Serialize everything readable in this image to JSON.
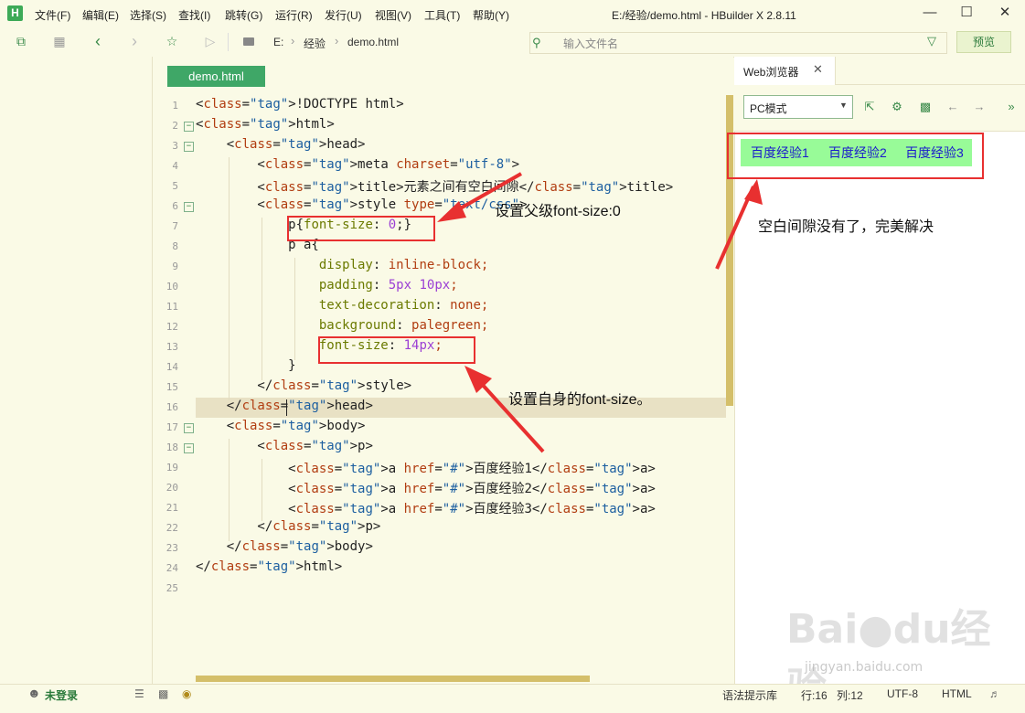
{
  "titlebar": {
    "app_logo": "H",
    "menu": [
      "文件(F)",
      "编辑(E)",
      "选择(S)",
      "查找(I)",
      "跳转(G)",
      "运行(R)",
      "发行(U)",
      "视图(V)",
      "工具(T)",
      "帮助(Y)"
    ],
    "window_title": "E:/经验/demo.html - HBuilder X 2.8.11"
  },
  "toolbar": {
    "breadcrumb": [
      "E:",
      "经验",
      "demo.html"
    ],
    "file_search_placeholder": "输入文件名",
    "preview_label": "预览"
  },
  "editor": {
    "tab_label": "demo.html",
    "line_numbers": [
      "1",
      "2",
      "3",
      "4",
      "5",
      "6",
      "7",
      "8",
      "9",
      "10",
      "11",
      "12",
      "13",
      "14",
      "15",
      "16",
      "17",
      "18",
      "19",
      "20",
      "21",
      "22",
      "23",
      "24",
      "25"
    ],
    "lines": [
      "<!DOCTYPE html>",
      "<html>",
      "    <head>",
      "        <meta charset=\"utf-8\">",
      "        <title>元素之间有空白间隙</title>",
      "        <style type=\"text/css\">",
      "            p{font-size: 0;}",
      "            p a{",
      "                display: inline-block;",
      "                padding: 5px 10px;",
      "                text-decoration: none;",
      "                background: palegreen;",
      "                font-size: 14px;",
      "            }",
      "        </style>",
      "    </head>",
      "    <body>",
      "        <p>",
      "            <a href=\"#\">百度经验1</a>",
      "            <a href=\"#\">百度经验2</a>",
      "            <a href=\"#\">百度经验3</a>",
      "        </p>",
      "    </body>",
      "</html>",
      ""
    ],
    "current_line": 16
  },
  "annotations": {
    "parent_font_size": "设置父级font-size:0",
    "self_font_size": "设置自身的font-size。",
    "result": "空白间隙没有了，完美解决"
  },
  "browser": {
    "tab_label": "Web浏览器",
    "mode_select": "PC模式",
    "links": [
      "百度经验1",
      "百度经验2",
      "百度经验3"
    ],
    "link_background": "#98fb98"
  },
  "statusbar": {
    "login": "未登录",
    "syntax_lib": "语法提示库",
    "row": "行:16",
    "col": "列:12",
    "encoding": "UTF-8",
    "language": "HTML"
  },
  "watermark": {
    "brand": "Baidu经验",
    "url": "jingyan.baidu.com"
  },
  "colors": {
    "accent_green": "#3fa767",
    "annotation_red": "#e83030",
    "editor_bg": "#fafae6"
  }
}
